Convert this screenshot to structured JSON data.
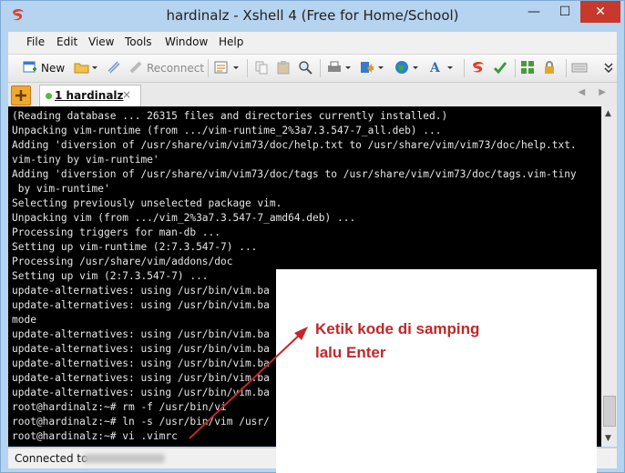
{
  "window": {
    "title": "hardinalz - Xshell 4 (Free for Home/School)",
    "min_glyph": "—",
    "max_glyph": "☐",
    "close_glyph": "✕"
  },
  "menu": [
    "File",
    "Edit",
    "View",
    "Tools",
    "Window",
    "Help"
  ],
  "toolbar": {
    "new_label": "New",
    "reconnect_label": "Reconnect"
  },
  "tab": {
    "label": "1 hardinalz",
    "close_glyph": "×",
    "arrows": "◀ ▶"
  },
  "terminal": {
    "lines": [
      "(Reading database ... 26315 files and directories currently installed.)",
      "Unpacking vim-runtime (from .../vim-runtime_2%3a7.3.547-7_all.deb) ...",
      "Adding 'diversion of /usr/share/vim/vim73/doc/help.txt to /usr/share/vim/vim73/doc/help.txt.",
      "vim-tiny by vim-runtime'",
      "Adding 'diversion of /usr/share/vim/vim73/doc/tags to /usr/share/vim/vim73/doc/tags.vim-tiny",
      " by vim-runtime'",
      "Selecting previously unselected package vim.",
      "Unpacking vim (from .../vim_2%3a7.3.547-7_amd64.deb) ...",
      "Processing triggers for man-db ...",
      "Setting up vim-runtime (2:7.3.547-7) ...",
      "Processing /usr/share/vim/addons/doc",
      "Setting up vim (2:7.3.547-7) ...",
      "update-alternatives: using /usr/bin/vim.ba",
      "update-alternatives: using /usr/bin/vim.ba",
      "mode",
      "update-alternatives: using /usr/bin/vim.ba",
      "update-alternatives: using /usr/bin/vim.ba",
      "update-alternatives: using /usr/bin/vim.ba",
      "update-alternatives: using /usr/bin/vim.ba",
      "update-alternatives: using /usr/bin/vim.ba",
      "root@hardinalz:~# rm -f /usr/bin/vi",
      "root@hardinalz:~# ln -s /usr/bin/vim /usr/",
      "root@hardinalz:~# vi .vimrc"
    ]
  },
  "status": {
    "text": "Connected to"
  },
  "annotation": {
    "line1": "Ketik kode di samping",
    "line2": "lalu Enter",
    "color": "#c0282a"
  }
}
